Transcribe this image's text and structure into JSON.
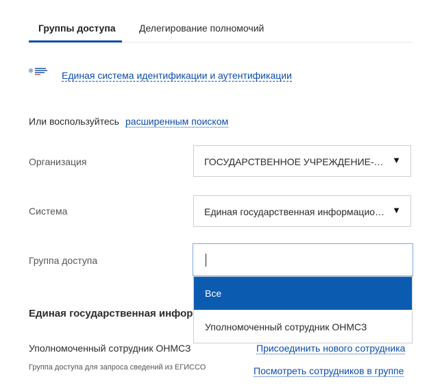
{
  "tabs": [
    {
      "label": "Группы доступа",
      "active": true
    },
    {
      "label": "Делегирование полномочий",
      "active": false
    }
  ],
  "system": {
    "logo_icon": "ministry-logo-icon",
    "link_label": "Единая система идентификации и аутентификации"
  },
  "search": {
    "prefix": "Или воспользуйтесь",
    "advanced_link": "расширенным поиском"
  },
  "form": {
    "organization": {
      "label": "Организация",
      "value": "ГОСУДАРСТВЕННОЕ УЧРЕЖДЕНИЕ-ОТДЕЛЕНИЕ ПЕНСИОННОГО ФОНДА",
      "arrow_icon": "triangle-down-icon"
    },
    "system": {
      "label": "Система",
      "value": "Единая государственная информационная система социального обеспечения",
      "arrow_icon": "triangle-down-icon"
    },
    "access_group": {
      "label": "Группа доступа",
      "input_value": "",
      "options": [
        {
          "label": "Все",
          "selected": true
        },
        {
          "label": "Уполномоченный сотрудник ОНМСЗ",
          "selected": false
        }
      ]
    }
  },
  "section": {
    "title": "Единая государственная информационная система социального обеспечения",
    "rows": [
      {
        "title": "Уполномоченный сотрудник ОНМСЗ",
        "action": "Присоединить нового сотрудника"
      },
      {
        "title": "Группа доступа для запроса сведений из ЕГИССО",
        "action": "Посмотреть сотрудников в группе"
      }
    ]
  },
  "colors": {
    "accent": "#0b4ca8",
    "selected_option_bg": "#0b5bb0",
    "border": "#c9cdd3",
    "focus_border": "#7aa8e0"
  }
}
